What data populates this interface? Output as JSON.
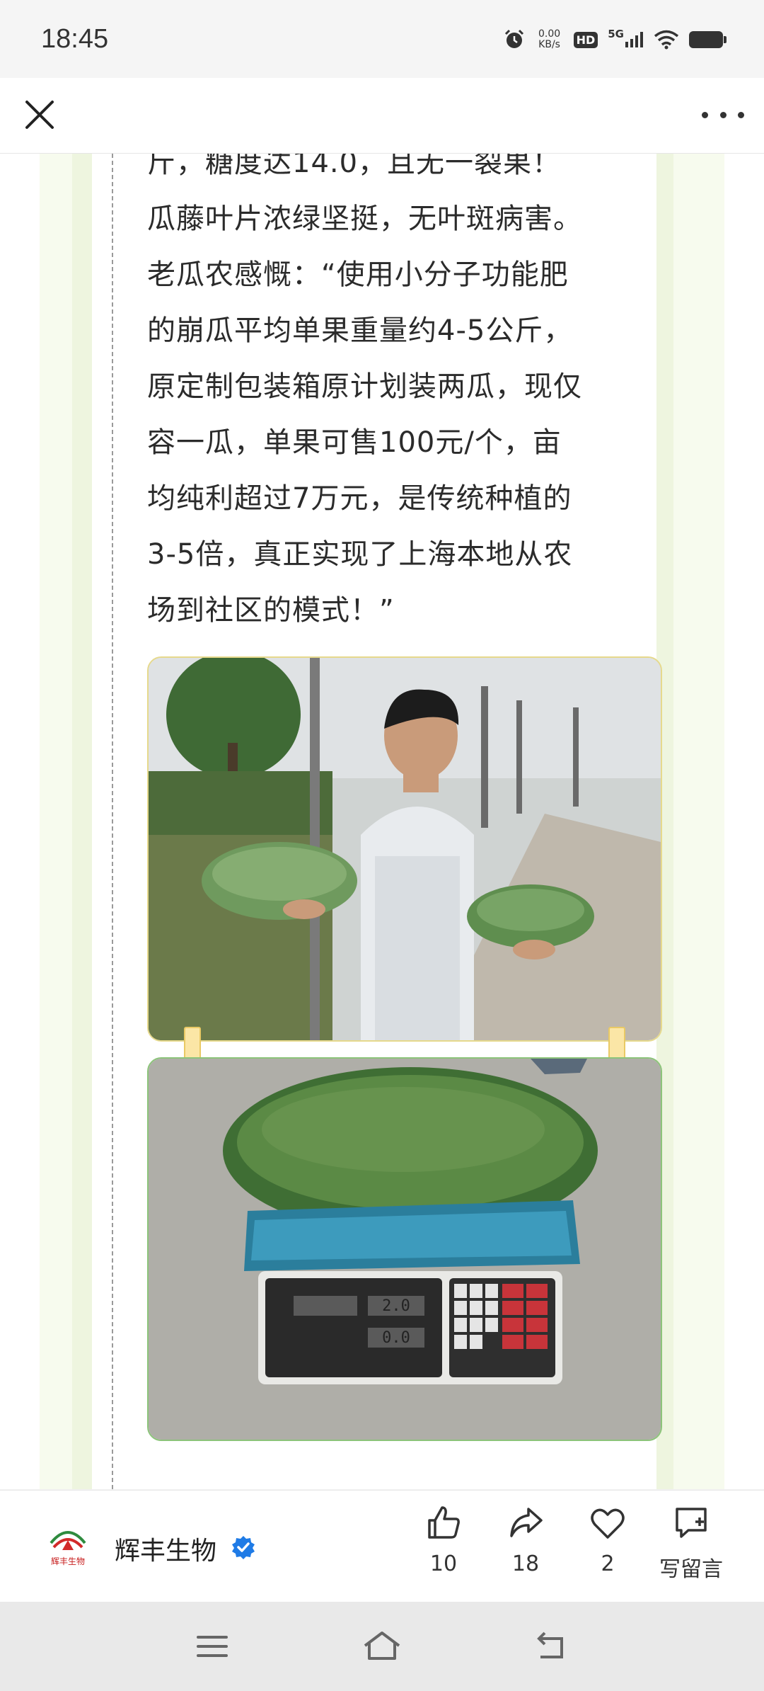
{
  "status_bar": {
    "time": "18:45",
    "net_speed_value": "0.00",
    "net_speed_unit": "KB/s",
    "hd_label": "HD",
    "network_label": "5G",
    "icons": [
      "alarm-icon",
      "hd-icon",
      "signal-5g-icon",
      "wifi-icon",
      "battery-icon"
    ]
  },
  "top_bar": {
    "close_icon": "close-icon",
    "more_icon": "more-icon"
  },
  "article": {
    "lines": [
      "斤，糖度达14.0，且无一裂果！",
      "瓜藤叶片浓绿坚挺，无叶斑病害。",
      "老瓜农感慨：“使用小分子功能肥",
      "的崩瓜平均单果重量约4-5公斤，",
      "原定制包装箱原计划装两瓜，现仅",
      "容一瓜，单果可售100元/个，亩",
      "均纯利超过7万元，是传统种植的",
      "3-5倍，真正实现了上海本地从农",
      "场到社区的模式！”"
    ],
    "scale_display": [
      "2.0",
      "0.0"
    ]
  },
  "bottom_bar": {
    "account_name": "辉丰生物",
    "logo_text": "辉丰生物",
    "like_count": "10",
    "share_count": "18",
    "favorite_count": "2",
    "comment_label": "写留言",
    "verified_color": "#1f7be6"
  },
  "nav_bar": {
    "icons": [
      "menu-icon",
      "home-icon",
      "back-icon"
    ]
  }
}
